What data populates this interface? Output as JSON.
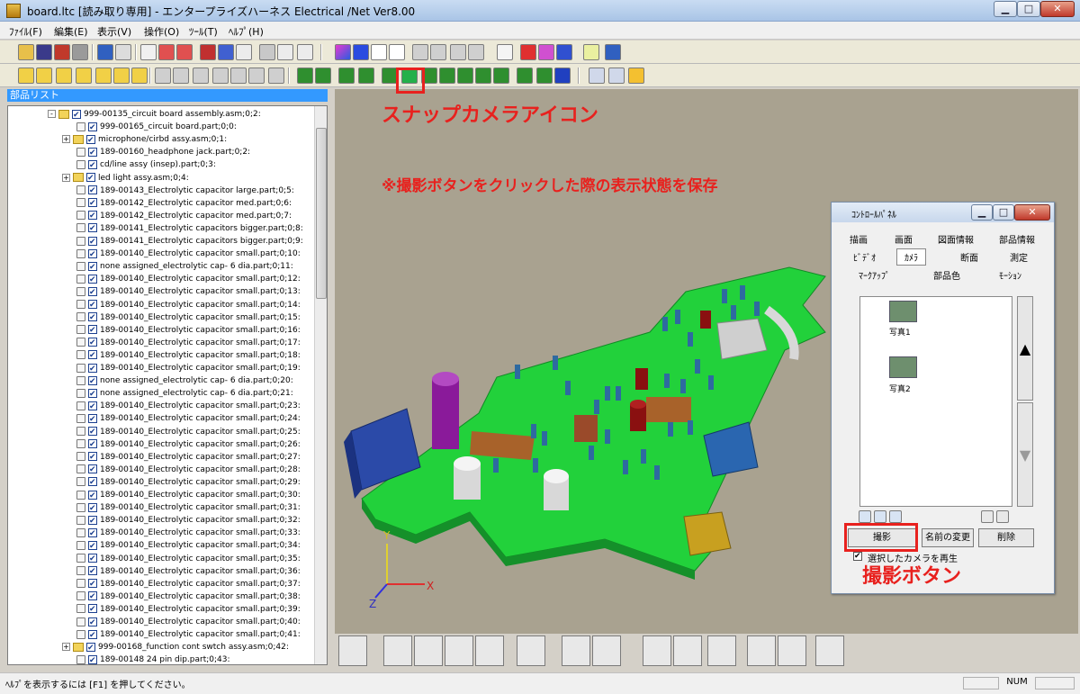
{
  "window": {
    "title": "board.ltc [読み取り専用] - エンタープライズハーネス Electrical /Net Ver8.00",
    "minimize": "▁",
    "maximize": "□",
    "close": "✕"
  },
  "menu": [
    "ﾌｧｲﾙ(F)",
    "編集(E)",
    "表示(V)",
    "操作(O)",
    "ﾂｰﾙ(T)",
    "ﾍﾙﾌﾟ(H)"
  ],
  "parts_panel": {
    "title": "部品リスト",
    "rows": [
      "999-00135_circuit  board assembly.asm;0;2:",
      "999-00165_circuit board.part;0;0:",
      "microphone/cirbd assy.asm;0;1:",
      "189-00160_headphone jack.part;0;2:",
      "cd/line assy  (insep).part;0;3:",
      "led light assy.asm;0;4:",
      "189-00143_Electrolytic capacitor large.part;0;5:",
      "189-00142_Electrolytic capacitor med.part;0;6:",
      "189-00142_Electrolytic capacitor med.part;0;7:",
      "189-00141_Electrolytic capacitors bigger.part;0;8:",
      "189-00141_Electrolytic capacitors bigger.part;0;9:",
      "189-00140_Electrolytic capacitor small.part;0;10:",
      "none assigned_electrolytic  cap- 6 dia.part;0;11:",
      "189-00140_Electrolytic capacitor small.part;0;12:",
      "189-00140_Electrolytic capacitor small.part;0;13:",
      "189-00140_Electrolytic capacitor small.part;0;14:",
      "189-00140_Electrolytic capacitor small.part;0;15:",
      "189-00140_Electrolytic capacitor small.part;0;16:",
      "189-00140_Electrolytic capacitor small.part;0;17:",
      "189-00140_Electrolytic capacitor small.part;0;18:",
      "189-00140_Electrolytic capacitor small.part;0;19:",
      "none assigned_electrolytic  cap- 6 dia.part;0;20:",
      "none assigned_electrolytic  cap- 6 dia.part;0;21:",
      "189-00140_Electrolytic capacitor small.part;0;23:",
      "189-00140_Electrolytic capacitor small.part;0;24:",
      "189-00140_Electrolytic capacitor small.part;0;25:",
      "189-00140_Electrolytic capacitor small.part;0;26:",
      "189-00140_Electrolytic capacitor small.part;0;27:",
      "189-00140_Electrolytic capacitor small.part;0;28:",
      "189-00140_Electrolytic capacitor small.part;0;29:",
      "189-00140_Electrolytic capacitor small.part;0;30:",
      "189-00140_Electrolytic capacitor small.part;0;31:",
      "189-00140_Electrolytic capacitor small.part;0;32:",
      "189-00140_Electrolytic capacitor small.part;0;33:",
      "189-00140_Electrolytic capacitor small.part;0;34:",
      "189-00140_Electrolytic capacitor small.part;0;35:",
      "189-00140_Electrolytic capacitor small.part;0;36:",
      "189-00140_Electrolytic capacitor small.part;0;37:",
      "189-00140_Electrolytic capacitor small.part;0;38:",
      "189-00140_Electrolytic capacitor small.part;0;39:",
      "189-00140_Electrolytic capacitor small.part;0;40:",
      "189-00140_Electrolytic capacitor small.part;0;41:",
      "999-00168_function cont swtch assy.asm;0;42:",
      "189-00148 24 pin dip.part;0;43:"
    ]
  },
  "viewport": {
    "background": "#a9a290",
    "axis_x": "X",
    "axis_y": "Y",
    "axis_z": "Z"
  },
  "annotations": {
    "snap_camera": "スナップカメラアイコン",
    "save_note": "※撮影ボタンをクリックした際の表示状態を保存",
    "shoot_button": "撮影ボタン"
  },
  "control_panel": {
    "title": "ｺﾝﾄﾛｰﾙﾊﾟﾈﾙ",
    "tabs_row1": [
      "描画",
      "画面",
      "図面情報",
      "部品情報"
    ],
    "tabs_row2": [
      "ﾋﾞﾃﾞｵ",
      "ｶﾒﾗ",
      "断面",
      "測定"
    ],
    "tabs_row3": [
      "ﾏｰｸｱｯﾌﾟ",
      "部品色",
      "ﾓｰｼｮﾝ"
    ],
    "photos": [
      "写真1",
      "写真2"
    ],
    "scroll_up": "▲",
    "scroll_down": "▼",
    "buttons": {
      "shoot": "撮影",
      "rename": "名前の変更",
      "delete": "削除"
    },
    "checkbox": "選択したカメラを再生"
  },
  "status_bar": {
    "help": "ﾍﾙﾌﾟを表示するには [F1] を押してください。",
    "num": "NUM"
  },
  "colors": {
    "accent": "#e8211e",
    "board": "#22d13b",
    "selection": "#3399ff"
  }
}
